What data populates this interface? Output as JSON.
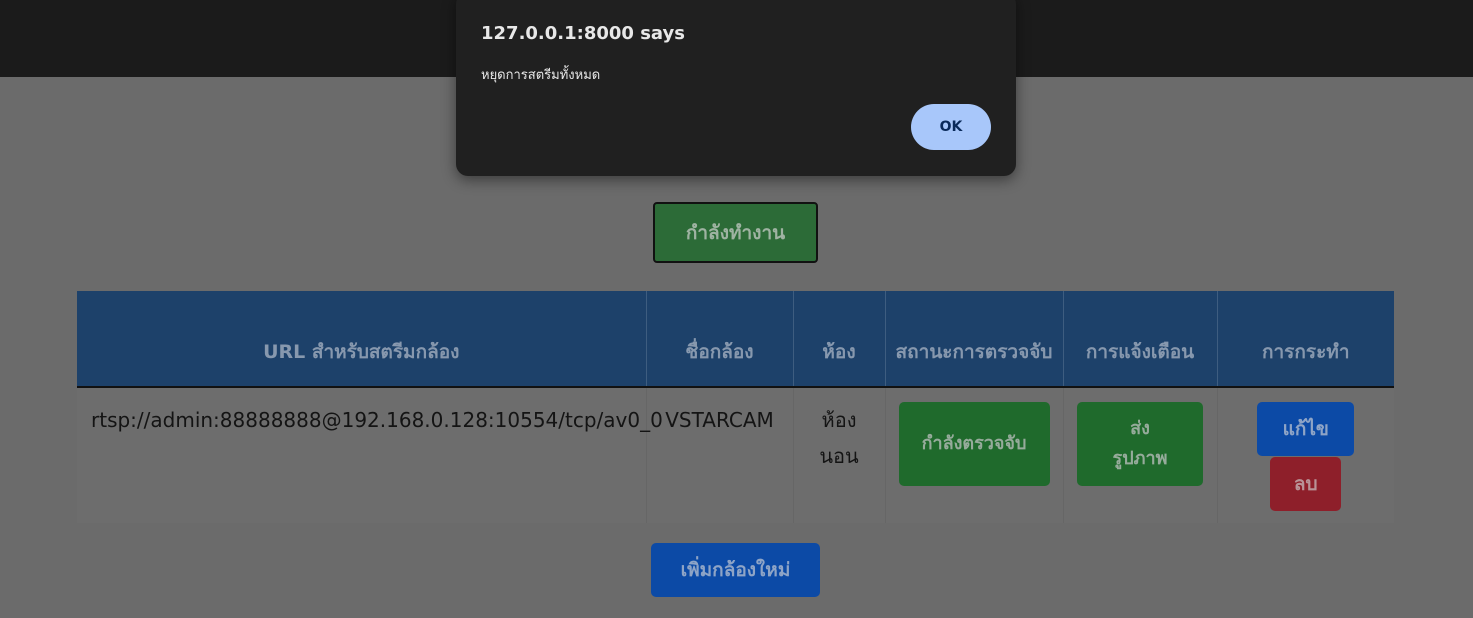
{
  "dialog": {
    "title": "127.0.0.1:8000 says",
    "message": "หยุดการสตรีมทั้งหมด",
    "ok_label": "OK"
  },
  "status_button": "กำลังทำงาน",
  "table": {
    "headers": {
      "url": "URL สำหรับสตรีมกล้อง",
      "name": "ชื่อกล้อง",
      "room": "ห้อง",
      "detect_status": "สถานะการตรวจจับ",
      "notify": "การแจ้งเตือน",
      "actions": "การกระทำ"
    },
    "rows": [
      {
        "url": "rtsp://admin:88888888@192.168.0.128:10554/tcp/av0_0",
        "name": "VSTARCAM",
        "room": "ห้องนอน",
        "detect_label": "กำลังตรวจจับ",
        "notify_label": "ส่ง รูปภาพ",
        "edit_label": "แก้ไข",
        "delete_label": "ลบ"
      }
    ]
  },
  "add_camera_label": "เพิ่มกล้องใหม่",
  "colors": {
    "dialog_bg": "#202020",
    "ok_button": "#a8c7fa",
    "header_bg": "#1d416a",
    "green": "#1f6a2c",
    "blue": "#0c4aa6",
    "red": "#8e1f2a"
  }
}
